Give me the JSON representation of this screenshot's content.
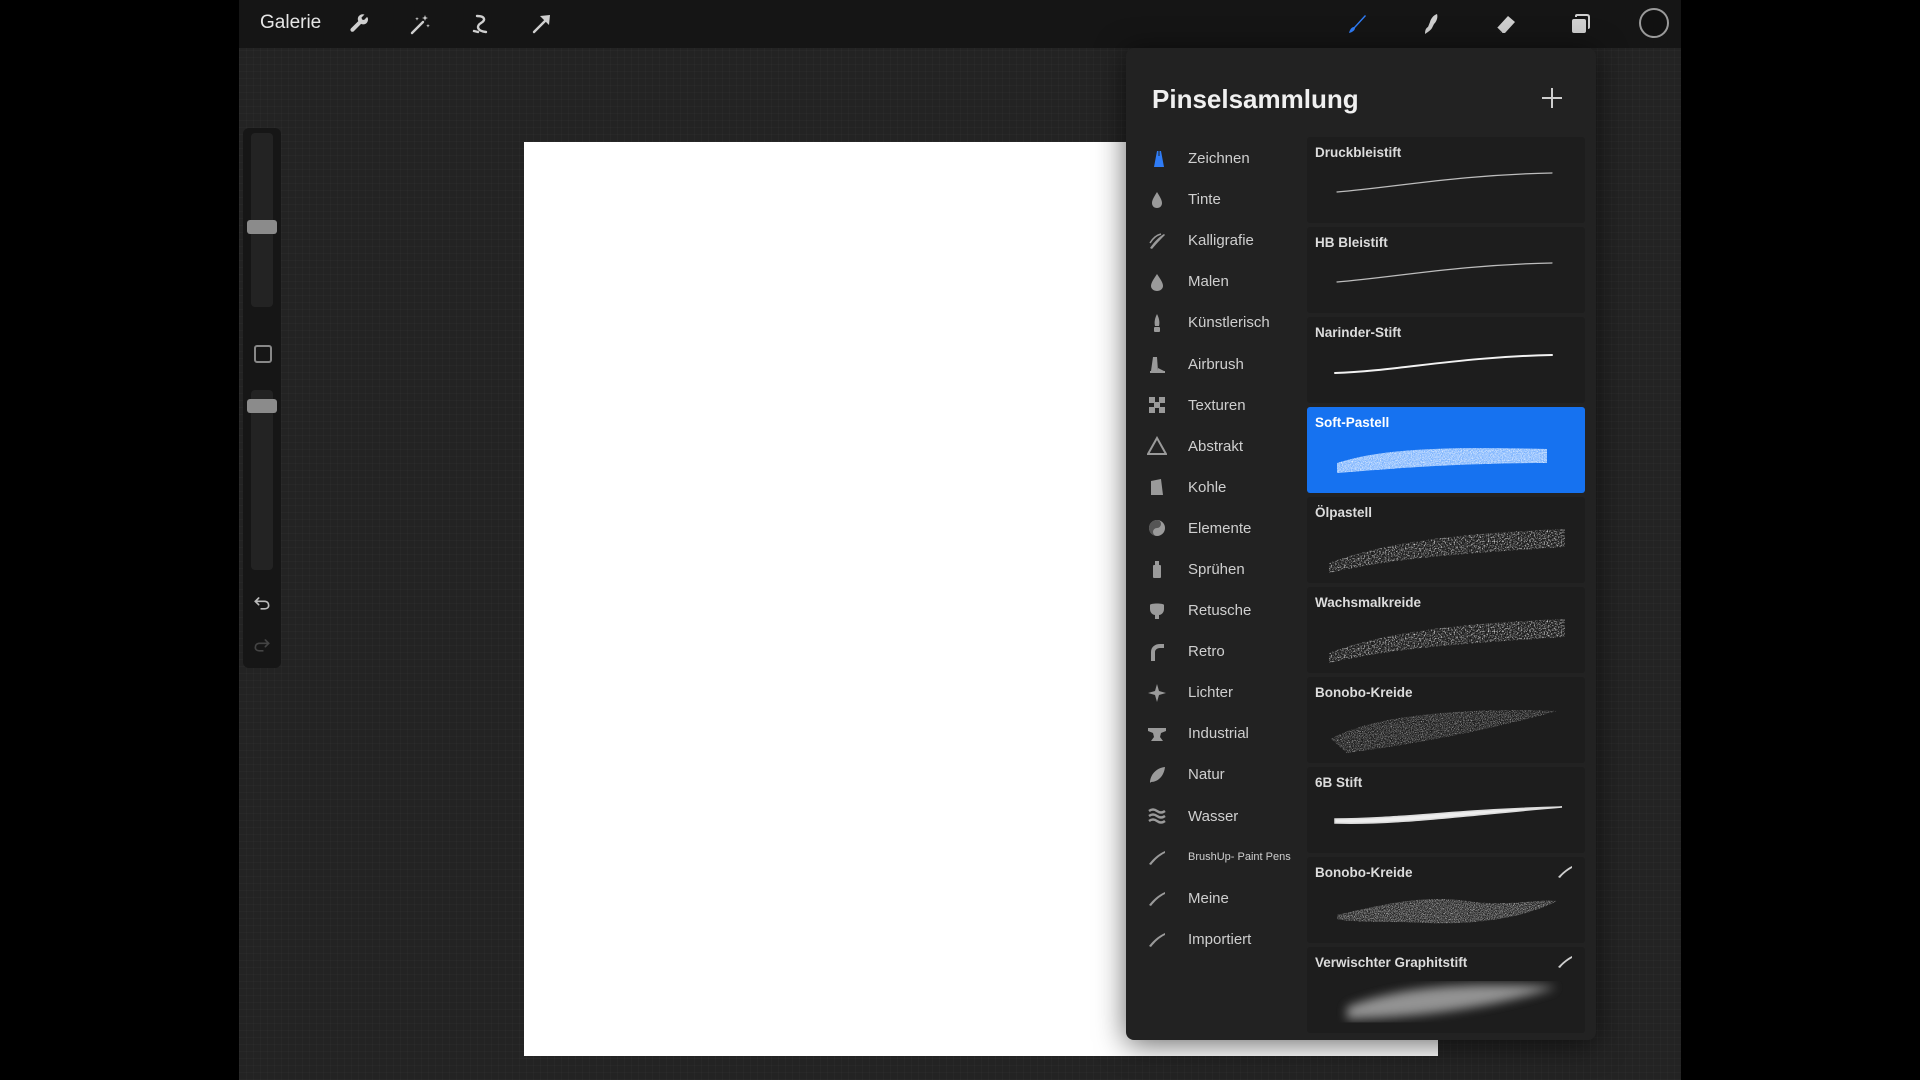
{
  "topbar": {
    "gallery": "Galerie",
    "tools_left": [
      "wrench-icon",
      "magic-wand-icon",
      "selection-icon",
      "transform-arrow-icon"
    ],
    "tools_right": [
      "brush-icon",
      "smudge-icon",
      "eraser-icon",
      "layers-icon"
    ],
    "active_tool_color": "#2f7cf6",
    "current_color": "#111111"
  },
  "panel": {
    "title": "Pinselsammlung",
    "categories": [
      {
        "label": "Zeichnen",
        "icon": "pencil-tip-icon",
        "active": true
      },
      {
        "label": "Tinte",
        "icon": "ink-drop-icon"
      },
      {
        "label": "Kalligrafie",
        "icon": "calligraphy-icon"
      },
      {
        "label": "Malen",
        "icon": "paint-drop-icon"
      },
      {
        "label": "Künstlerisch",
        "icon": "artistic-brush-icon"
      },
      {
        "label": "Airbrush",
        "icon": "airbrush-icon"
      },
      {
        "label": "Texturen",
        "icon": "texture-icon"
      },
      {
        "label": "Abstrakt",
        "icon": "triangle-icon"
      },
      {
        "label": "Kohle",
        "icon": "charcoal-icon"
      },
      {
        "label": "Elemente",
        "icon": "yin-yang-icon"
      },
      {
        "label": "Sprühen",
        "icon": "spray-can-icon"
      },
      {
        "label": "Retusche",
        "icon": "retouch-icon"
      },
      {
        "label": "Retro",
        "icon": "retro-icon"
      },
      {
        "label": "Lichter",
        "icon": "sparkle-icon"
      },
      {
        "label": "Industrial",
        "icon": "anvil-icon"
      },
      {
        "label": "Natur",
        "icon": "leaf-icon"
      },
      {
        "label": "Wasser",
        "icon": "waves-icon"
      },
      {
        "label": "BrushUp- Paint Pens",
        "icon": "brush-stroke-icon",
        "small": true
      },
      {
        "label": "Meine",
        "icon": "brush-stroke-icon"
      },
      {
        "label": "Importiert",
        "icon": "brush-stroke-icon"
      }
    ],
    "brushes": [
      {
        "name": "Druckbleistift",
        "style": "thin"
      },
      {
        "name": "HB Bleistift",
        "style": "thin"
      },
      {
        "name": "Narinder-Stift",
        "style": "pen"
      },
      {
        "name": "Soft-Pastell",
        "style": "pastel",
        "selected": true
      },
      {
        "name": "Ölpastell",
        "style": "oil"
      },
      {
        "name": "Wachsmalkreide",
        "style": "wax"
      },
      {
        "name": "Bonobo-Kreide",
        "style": "chalk"
      },
      {
        "name": "6B Stift",
        "style": "pencil6b"
      },
      {
        "name": "Bonobo-Kreide",
        "style": "chalk2",
        "imported": true
      },
      {
        "name": "Verwischter Graphitstift",
        "style": "smudge",
        "imported": true
      }
    ],
    "selected_color": "#1672f0"
  }
}
